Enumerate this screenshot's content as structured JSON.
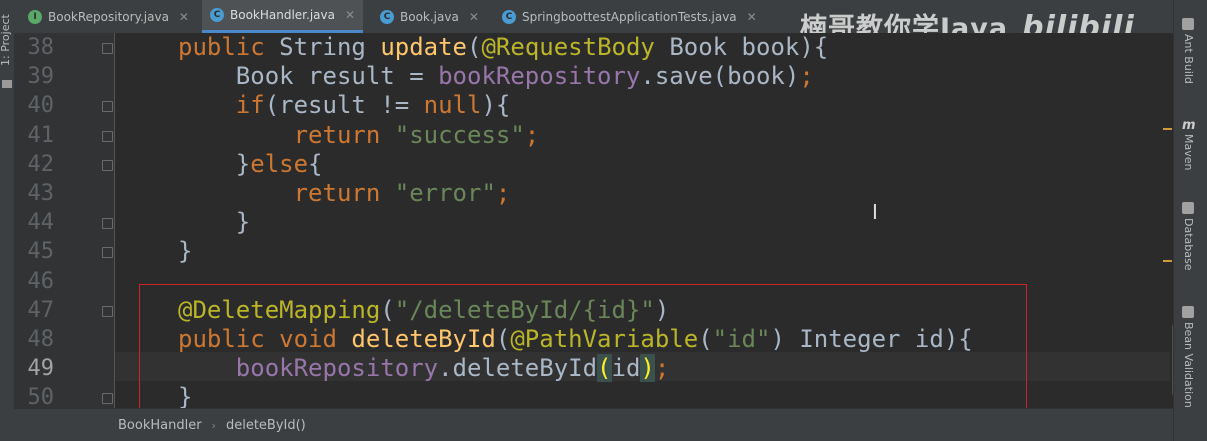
{
  "tabs": [
    {
      "label": "BookRepository.java",
      "icon": "interface-icon",
      "icon_color": "#59a869",
      "icon_glyph": "I",
      "active": false
    },
    {
      "label": "BookHandler.java",
      "icon": "class-icon",
      "icon_color": "#4a9bd0",
      "icon_glyph": "C",
      "active": true
    },
    {
      "label": "Book.java",
      "icon": "class-icon",
      "icon_color": "#4a9bd0",
      "icon_glyph": "C",
      "active": false
    },
    {
      "label": "SpringboottestApplicationTests.java",
      "icon": "test-class-icon",
      "icon_color": "#4a9bd0",
      "icon_glyph": "C",
      "active": false
    }
  ],
  "tab_close": "✕",
  "watermark": {
    "text": "楠哥教你学Java",
    "brand": "bilibili"
  },
  "left_panel": {
    "label": "1: Project"
  },
  "right_panel": [
    {
      "label": "Ant Build",
      "icon": "ant-build-icon"
    },
    {
      "label": "Maven",
      "icon": "maven-icon",
      "glyph": "m"
    },
    {
      "label": "Database",
      "icon": "database-icon"
    },
    {
      "label": "Bean Validation",
      "icon": "bean-validation-icon"
    }
  ],
  "editor": {
    "current_line": 49,
    "lines": [
      {
        "n": 38,
        "tokens": [
          [
            "kw",
            "public "
          ],
          [
            "pl",
            "String "
          ],
          [
            "fn",
            "update"
          ],
          [
            "pl",
            "("
          ],
          [
            "ann",
            "@RequestBody "
          ],
          [
            "pl",
            "Book book){"
          ]
        ]
      },
      {
        "n": 39,
        "tokens": [
          [
            "pl",
            "    Book result = "
          ],
          [
            "fld",
            "bookRepository"
          ],
          [
            "pl",
            ".save(book)"
          ],
          [
            "kw",
            ";"
          ]
        ]
      },
      {
        "n": 40,
        "tokens": [
          [
            "pl",
            "    "
          ],
          [
            "kw",
            "if"
          ],
          [
            "pl",
            "(result != "
          ],
          [
            "kw",
            "null"
          ],
          [
            "pl",
            "){"
          ]
        ]
      },
      {
        "n": 41,
        "tokens": [
          [
            "pl",
            "        "
          ],
          [
            "kw",
            "return "
          ],
          [
            "str",
            "\"success\""
          ],
          [
            "kw",
            ";"
          ]
        ]
      },
      {
        "n": 42,
        "tokens": [
          [
            "pl",
            "    }"
          ],
          [
            "kw",
            "else"
          ],
          [
            "pl",
            "{"
          ]
        ]
      },
      {
        "n": 43,
        "tokens": [
          [
            "pl",
            "        "
          ],
          [
            "kw",
            "return "
          ],
          [
            "str",
            "\"error\""
          ],
          [
            "kw",
            ";"
          ]
        ]
      },
      {
        "n": 44,
        "tokens": [
          [
            "pl",
            "    }"
          ]
        ]
      },
      {
        "n": 45,
        "tokens": [
          [
            "pl",
            "}"
          ]
        ]
      },
      {
        "n": 46,
        "tokens": []
      },
      {
        "n": 47,
        "tokens": [
          [
            "ann",
            "@DeleteMapping"
          ],
          [
            "pl",
            "("
          ],
          [
            "str",
            "\"/deleteById/{id}\""
          ],
          [
            "pl",
            ")"
          ]
        ]
      },
      {
        "n": 48,
        "tokens": [
          [
            "kw",
            "public void "
          ],
          [
            "fn",
            "deleteById"
          ],
          [
            "pl",
            "("
          ],
          [
            "ann",
            "@PathVariable"
          ],
          [
            "pl",
            "("
          ],
          [
            "str",
            "\"id\""
          ],
          [
            "pl",
            ") Integer id){"
          ]
        ]
      },
      {
        "n": 49,
        "tokens": [
          [
            "pl",
            "    "
          ],
          [
            "fld",
            "bookRepository"
          ],
          [
            "pl",
            ".deleteById"
          ],
          [
            "brace",
            "("
          ],
          [
            "pl",
            "id"
          ],
          [
            "brace",
            ")"
          ],
          [
            "kw",
            ";"
          ]
        ]
      },
      {
        "n": 50,
        "tokens": [
          [
            "pl",
            "}"
          ]
        ]
      }
    ]
  },
  "breadcrumb": [
    "BookHandler",
    "deleteById()"
  ],
  "breadcrumb_sep": "›",
  "mouse_cursor": "text-cursor-icon",
  "colors": {
    "keyword": "#cc7832",
    "annotation": "#bbb529",
    "method": "#ffc66d",
    "field": "#9876aa",
    "string": "#6a8759",
    "text": "#a9b7c6",
    "highlight_box": "#d02525"
  }
}
